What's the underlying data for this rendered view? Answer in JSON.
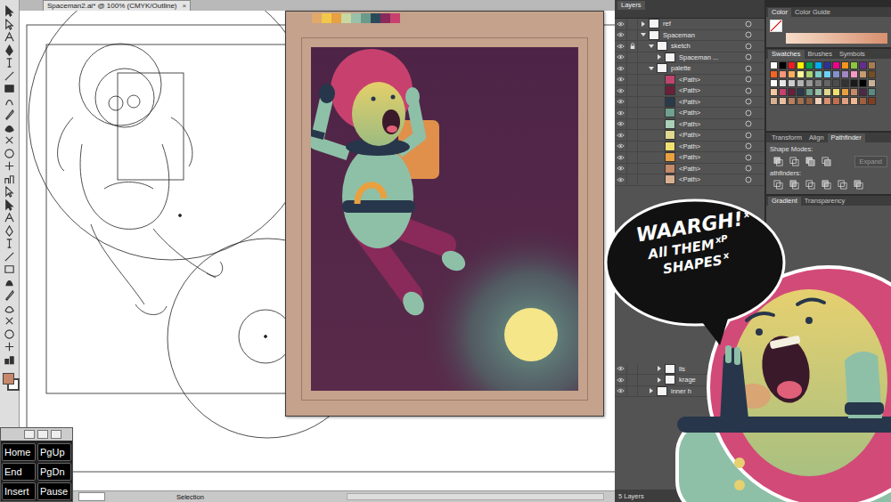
{
  "document": {
    "tab_title": "Spaceman2.ai* @ 100% (CMYK/Outline)",
    "close": "×",
    "tool_status": "Selection"
  },
  "preview_palette": [
    {
      "color": "#e2a86a"
    },
    {
      "color": "#f2c84a"
    },
    {
      "color": "#e8a040"
    },
    {
      "color": "#c8d8a0"
    },
    {
      "color": "#9ac0a8"
    },
    {
      "color": "#6a9a8a"
    },
    {
      "color": "#2a4a5a"
    },
    {
      "color": "#8a2a5a"
    },
    {
      "color": "#c8416e"
    }
  ],
  "layers": {
    "title": "Layers",
    "rows": [
      {
        "name": "ref",
        "kind": "layer",
        "depth": 0,
        "visible": true,
        "locked": false,
        "expanded": false
      },
      {
        "name": "Spaceman",
        "kind": "layer",
        "depth": 0,
        "visible": true,
        "locked": false,
        "expanded": true
      },
      {
        "name": "sketch",
        "kind": "layer",
        "depth": 1,
        "visible": true,
        "locked": true,
        "expanded": true
      },
      {
        "name": "Spaceman ...",
        "kind": "layer",
        "depth": 2,
        "visible": true,
        "locked": false,
        "expanded": false
      },
      {
        "name": "palette",
        "kind": "layer",
        "depth": 1,
        "visible": true,
        "locked": false,
        "expanded": true
      },
      {
        "name": "<Path>",
        "kind": "path",
        "depth": 2,
        "visible": true,
        "locked": false,
        "expanded": false,
        "color": "#c0456e"
      },
      {
        "name": "<Path>",
        "kind": "path",
        "depth": 2,
        "visible": true,
        "locked": false,
        "expanded": false,
        "color": "#6a1f3a"
      },
      {
        "name": "<Path>",
        "kind": "path",
        "depth": 2,
        "visible": true,
        "locked": false,
        "expanded": false,
        "color": "#2a3a4a"
      },
      {
        "name": "<Path>",
        "kind": "path",
        "depth": 2,
        "visible": true,
        "locked": false,
        "expanded": false,
        "color": "#6fa090"
      },
      {
        "name": "<Path>",
        "kind": "path",
        "depth": 2,
        "visible": true,
        "locked": false,
        "expanded": false,
        "color": "#a8d0b8"
      },
      {
        "name": "<Path>",
        "kind": "path",
        "depth": 2,
        "visible": true,
        "locked": false,
        "expanded": false,
        "color": "#e0d890"
      },
      {
        "name": "<Path>",
        "kind": "path",
        "depth": 2,
        "visible": true,
        "locked": false,
        "expanded": false,
        "color": "#f0e070"
      },
      {
        "name": "<Path>",
        "kind": "path",
        "depth": 2,
        "visible": true,
        "locked": false,
        "expanded": false,
        "color": "#e8a040"
      },
      {
        "name": "<Path>",
        "kind": "path",
        "depth": 2,
        "visible": true,
        "locked": false,
        "expanded": false,
        "color": "#c48a6a"
      },
      {
        "name": "<Path>",
        "kind": "path",
        "depth": 2,
        "visible": true,
        "locked": false,
        "expanded": false,
        "color": "#d8b090"
      }
    ],
    "lower_rows": [
      {
        "name": "lls",
        "kind": "layer",
        "depth": 2,
        "visible": true,
        "locked": false,
        "expanded": false
      },
      {
        "name": "krage",
        "kind": "layer",
        "depth": 2,
        "visible": true,
        "locked": false,
        "expanded": false
      },
      {
        "name": "inner h",
        "kind": "layer",
        "depth": 1,
        "visible": true,
        "locked": false,
        "expanded": false
      }
    ],
    "footer": "5 Layers"
  },
  "color_panel": {
    "tabs": [
      {
        "label": "Color",
        "selected": true
      },
      {
        "label": "Color Guide",
        "selected": false
      }
    ]
  },
  "swatches_panel": {
    "tabs": [
      {
        "label": "Swatches",
        "selected": true
      },
      {
        "label": "Brushes",
        "selected": false
      },
      {
        "label": "Symbols",
        "selected": false
      }
    ],
    "swatches": [
      {
        "color": "#ffffff"
      },
      {
        "color": "#000000"
      },
      {
        "color": "#ed1c24"
      },
      {
        "color": "#fff200"
      },
      {
        "color": "#00a651"
      },
      {
        "color": "#00aeef"
      },
      {
        "color": "#2e3192"
      },
      {
        "color": "#ec008c"
      },
      {
        "color": "#f7941d"
      },
      {
        "color": "#8dc63f"
      },
      {
        "color": "#662d91"
      },
      {
        "color": "#a67c52"
      },
      {
        "color": "#f26522"
      },
      {
        "color": "#f7977a"
      },
      {
        "color": "#fbaf5d"
      },
      {
        "color": "#fff799"
      },
      {
        "color": "#acd373"
      },
      {
        "color": "#7accc8"
      },
      {
        "color": "#6dcff6"
      },
      {
        "color": "#8393ca"
      },
      {
        "color": "#a187be"
      },
      {
        "color": "#f49ac2"
      },
      {
        "color": "#c69c6d"
      },
      {
        "color": "#754c24"
      },
      {
        "color": "#fefefe"
      },
      {
        "color": "#e6e6e6"
      },
      {
        "color": "#cccccc"
      },
      {
        "color": "#b3b3b3"
      },
      {
        "color": "#999999"
      },
      {
        "color": "#808080"
      },
      {
        "color": "#666666"
      },
      {
        "color": "#4d4d4d"
      },
      {
        "color": "#333333"
      },
      {
        "color": "#1a1a1a"
      },
      {
        "color": "#010101"
      },
      {
        "color": "#c7b299"
      },
      {
        "color": "#f4c8a0"
      },
      {
        "color": "#c8416e"
      },
      {
        "color": "#6a1f3a"
      },
      {
        "color": "#2a3a4a"
      },
      {
        "color": "#6fa090"
      },
      {
        "color": "#9ac0a8"
      },
      {
        "color": "#e0d890"
      },
      {
        "color": "#f0e070"
      },
      {
        "color": "#e8a040"
      },
      {
        "color": "#c48a6a"
      },
      {
        "color": "#4d2847"
      },
      {
        "color": "#5a8a80"
      },
      {
        "color": "#d8b090"
      },
      {
        "color": "#e8c0a0"
      },
      {
        "color": "#b88060"
      },
      {
        "color": "#a07050"
      },
      {
        "color": "#906040"
      },
      {
        "color": "#f0d0b8"
      },
      {
        "color": "#d89070"
      },
      {
        "color": "#c07050"
      },
      {
        "color": "#e0a080"
      },
      {
        "color": "#f0b890"
      },
      {
        "color": "#a06040"
      },
      {
        "color": "#804020"
      }
    ]
  },
  "pathfinder_panel": {
    "tabs": [
      {
        "label": "Transform",
        "selected": false
      },
      {
        "label": "Align",
        "selected": false
      },
      {
        "label": "Pathfinder",
        "selected": true
      }
    ],
    "shape_modes_label": "Shape Modes:",
    "expand_button": "Expand",
    "pathfinders_label": "athfinders:"
  },
  "gradient_panel": {
    "tabs": [
      {
        "label": "Gradient",
        "selected": true
      },
      {
        "label": "Transparency",
        "selected": false
      }
    ]
  },
  "keyboard": {
    "keys": [
      "Home",
      "PgUp",
      "End",
      "PgDn",
      "Insert",
      "Pause"
    ]
  },
  "speech_bubble": {
    "lines": [
      {
        "text": "WAARGH!",
        "mark": "x"
      },
      {
        "text": "All THEM",
        "mark": "xP"
      },
      {
        "text": "SHAPES",
        "mark": "x"
      }
    ]
  }
}
